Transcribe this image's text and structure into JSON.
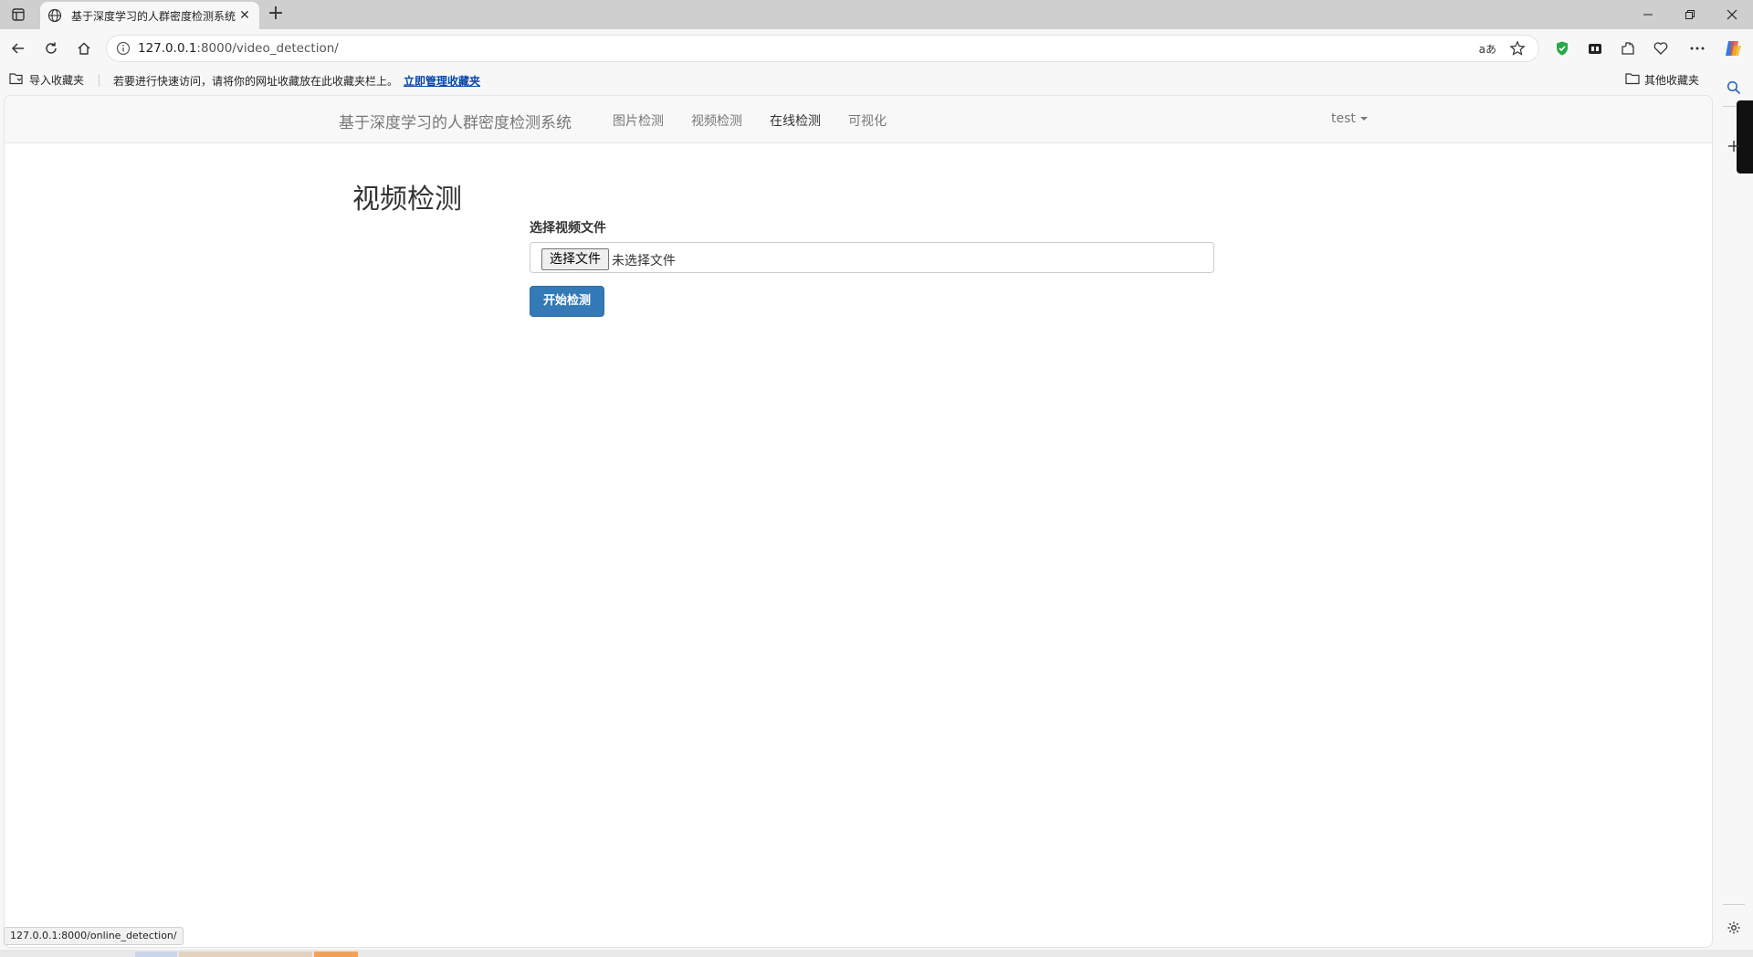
{
  "browser": {
    "tab_title": "基于深度学习的人群密度检测系统",
    "tab_close": "✕",
    "new_tab": "+",
    "url_host": "127.0.0.1",
    "url_path": ":8000/video_detection/",
    "read_aloud": "aあ",
    "status_url": "127.0.0.1:8000/online_detection/"
  },
  "bookmarks": {
    "import_label": "导入收藏夹",
    "message": "若要进行快速访问，请将你的网址收藏放在此收藏夹栏上。",
    "manage_link": "立即管理收藏夹",
    "other_label": "其他收藏夹"
  },
  "navbar": {
    "brand": "基于深度学习的人群密度检测系统",
    "items": [
      {
        "label": "图片检测"
      },
      {
        "label": "视频检测"
      },
      {
        "label": "在线检测"
      },
      {
        "label": "可视化"
      }
    ],
    "user": "test"
  },
  "main": {
    "title": "视频检测",
    "field_label": "选择视频文件",
    "file_button": "选择文件",
    "file_status": "未选择文件",
    "submit": "开始检测"
  },
  "colors": {
    "primary": "#337ab7",
    "navbar_bg": "#f8f8f8",
    "link": "#0645ad"
  },
  "icons": {
    "tab_actions": "tab-actions-icon",
    "globe": "globe-icon",
    "back": "back-arrow-icon",
    "refresh": "refresh-icon",
    "home": "home-icon",
    "info": "info-icon",
    "star": "star-icon",
    "shield": "shield-icon",
    "collections": "collections-icon",
    "extensions": "extensions-icon",
    "browser_essentials": "heart-icon",
    "more": "more-icon",
    "copilot": "copilot-icon",
    "search": "search-icon",
    "add": "plus-icon",
    "settings": "gear-icon",
    "folder": "folder-icon"
  }
}
